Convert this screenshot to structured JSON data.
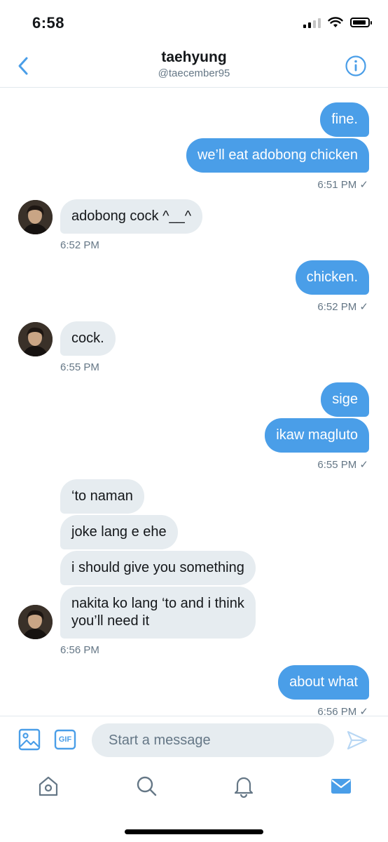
{
  "status_bar": {
    "time": "6:58"
  },
  "header": {
    "title": "taehyung",
    "handle": "@taecember95"
  },
  "messages": [
    {
      "text": "fine.",
      "side": "sent"
    },
    {
      "text": "we’ll eat adobong chicken",
      "side": "sent"
    },
    {
      "timestamp": "6:51 PM ✓"
    },
    {
      "text": "adobong cock ^__^",
      "side": "received"
    },
    {
      "timestamp": "6:52 PM"
    },
    {
      "text": "chicken.",
      "side": "sent"
    },
    {
      "timestamp": "6:52 PM ✓"
    },
    {
      "text": "cock.",
      "side": "received"
    },
    {
      "timestamp": "6:55 PM"
    },
    {
      "text": "sige",
      "side": "sent"
    },
    {
      "text": "ikaw magluto",
      "side": "sent"
    },
    {
      "timestamp": "6:55 PM ✓"
    },
    {
      "text": "‘to naman",
      "side": "received"
    },
    {
      "text": "joke lang e ehe",
      "side": "received"
    },
    {
      "text": "i should give you something",
      "side": "received"
    },
    {
      "text": "nakita ko lang ‘to and i think\nyou’ll need it",
      "side": "received"
    },
    {
      "timestamp": "6:56 PM"
    },
    {
      "text": "about what",
      "side": "sent"
    },
    {
      "timestamp": "6:56 PM ✓"
    }
  ],
  "composer": {
    "placeholder": "Start a message",
    "gif_label": "GIF"
  },
  "tabs": [
    {
      "icon": "home-icon"
    },
    {
      "icon": "search-icon"
    },
    {
      "icon": "bell-icon"
    },
    {
      "icon": "mail-icon",
      "active": true
    }
  ],
  "colors": {
    "accent": "#4a9ee8",
    "received_bubble": "#e6ecf0",
    "muted": "#657786"
  }
}
